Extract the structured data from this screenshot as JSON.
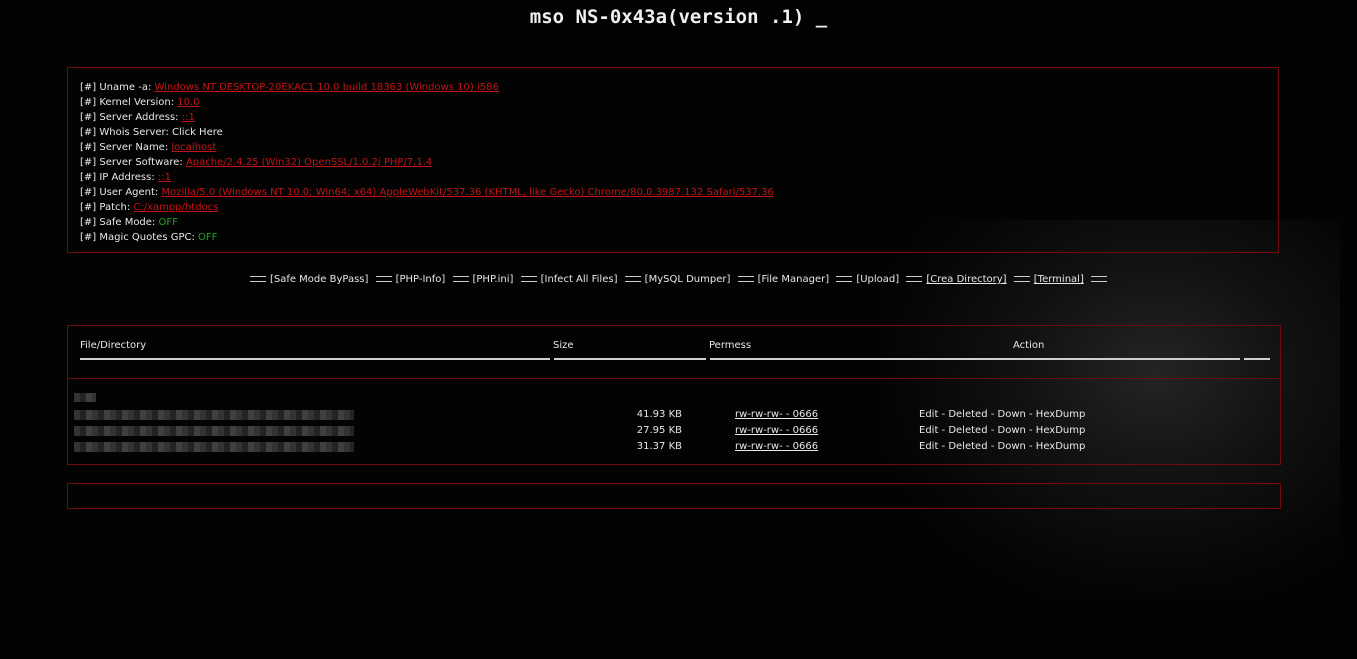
{
  "title": "mso NS-0x43a(version .1) _",
  "info": [
    {
      "label": "[#] Uname -a: ",
      "value": "Windows NT DESKTOP-20EKAC1 10.0 build 18363 (Windows 10) i586",
      "style": "red"
    },
    {
      "label": "[#] Kernel Version: ",
      "value": "10.0",
      "style": "red"
    },
    {
      "label": "[#] Server Address: ",
      "value": "::1",
      "style": "red"
    },
    {
      "label": "[#] Whois Server: ",
      "value": "Click Here",
      "style": "plain"
    },
    {
      "label": "[#] Server Name: ",
      "value": "localhost",
      "style": "red"
    },
    {
      "label": "[#] Server Software: ",
      "value": "Apache/2.4.25 (Win32) OpenSSL/1.0.2j PHP/7.1.4",
      "style": "red"
    },
    {
      "label": "[#] IP Address: ",
      "value": "::1",
      "style": "red"
    },
    {
      "label": "[#] User Agent: ",
      "value": "Mozilla/5.0 (Windows NT 10.0; Win64; x64) AppleWebKit/537.36 (KHTML, like Gecko) Chrome/80.0.3987.132 Safari/537.36",
      "style": "red"
    },
    {
      "label": "[#] Patch: ",
      "value": "C:/xampp/htdocs",
      "style": "red"
    },
    {
      "label": "[#] Safe Mode: ",
      "value": "OFF",
      "style": "green"
    },
    {
      "label": "[#] Magic Quotes GPC: ",
      "value": "OFF",
      "style": "green"
    }
  ],
  "menu": [
    {
      "label": "[Safe Mode ByPass]"
    },
    {
      "label": "[PHP-Info]"
    },
    {
      "label": "[PHP.ini]"
    },
    {
      "label": "[Infect All Files]"
    },
    {
      "label": "[MySQL Dumper]"
    },
    {
      "label": "[File Manager]"
    },
    {
      "label": "[Upload]"
    },
    {
      "label": "[Crea Directory]",
      "underline": true
    },
    {
      "label": "[Terminal]",
      "underline": true
    }
  ],
  "table": {
    "headers": {
      "file": "File/Directory",
      "size": "Size",
      "perm": "Permess",
      "action": "Action"
    },
    "rows": [
      {
        "size": "41.93 KB",
        "perm": "rw-rw-rw- - 0666",
        "actions": "Edit - Deleted - Down - HexDump"
      },
      {
        "size": "27.95 KB",
        "perm": "rw-rw-rw- - 0666",
        "actions": "Edit - Deleted - Down - HexDump"
      },
      {
        "size": "31.37 KB",
        "perm": "rw-rw-rw- - 0666",
        "actions": "Edit - Deleted - Down - HexDump"
      }
    ]
  },
  "colors": {
    "accent": "#c21414",
    "border": "#6b0d0d",
    "ok": "#1fa31f"
  }
}
